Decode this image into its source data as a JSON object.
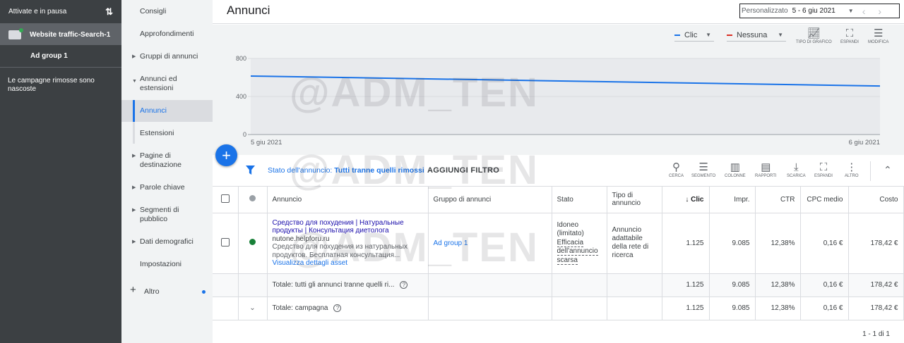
{
  "left_panel": {
    "filter_label": "Attivate e in pausa",
    "campaign": "Website traffic-Search-1",
    "ad_group": "Ad group 1",
    "note": "Le campagne rimosse sono nascoste"
  },
  "subnav": {
    "items": [
      {
        "label": "Consigli"
      },
      {
        "label": "Approfondimenti"
      },
      {
        "label": "Gruppi di annunci"
      },
      {
        "label": "Annunci ed estensioni"
      },
      {
        "label": "Annunci"
      },
      {
        "label": "Estensioni"
      },
      {
        "label": "Pagine di destinazione"
      },
      {
        "label": "Parole chiave"
      },
      {
        "label": "Segmenti di pubblico"
      },
      {
        "label": "Dati demografici"
      },
      {
        "label": "Impostazioni"
      },
      {
        "label": "Altro"
      }
    ]
  },
  "header": {
    "title": "Annunci",
    "date_label": "Personalizzato",
    "date_value": "5 - 6 giu 2021"
  },
  "chart_controls": {
    "metric1": "Clic",
    "metric2": "Nessuna",
    "metric1_color": "#1a73e8",
    "metric2_color": "#d93025",
    "chart_type": "TIPO DI GRAFICO",
    "expand": "ESPANDI",
    "edit": "MODIFICA"
  },
  "chart_data": {
    "type": "line",
    "x": [
      "5 giu 2021",
      "6 giu 2021"
    ],
    "series": [
      {
        "name": "Clic",
        "values": [
          615,
          510
        ]
      }
    ],
    "ylim": [
      0,
      800
    ],
    "yticks": [
      0,
      400,
      800
    ],
    "xlabels": [
      "5 giu 2021",
      "6 giu 2021"
    ],
    "grid": true
  },
  "filter": {
    "prefix": "Stato dell'annuncio:",
    "value": "Tutti tranne quelli rimossi",
    "add": "AGGIUNGI FILTRO"
  },
  "toolbar": {
    "search": "CERCA",
    "segment": "SEGMENTO",
    "columns": "COLONNE",
    "reports": "RAPPORTI",
    "download": "SCARICA",
    "expand": "ESPANDI",
    "more": "ALTRO"
  },
  "table": {
    "headers": {
      "ad": "Annuncio",
      "group": "Gruppo di annunci",
      "status": "Stato",
      "type": "Tipo di annuncio",
      "clicks": "Clic",
      "impr": "Impr.",
      "ctr": "CTR",
      "cpc": "CPC medio",
      "cost": "Costo"
    },
    "row": {
      "ad_headline": "Средство для похудения | Натуральные продукты | Консультация диетолога",
      "ad_url": "nutone.helpforu.ru",
      "ad_desc": "Средство для похудения из натуральных продуктов. Бесплатная консультация...",
      "ad_link": "Visualizza dettagli asset",
      "group": "Ad group 1",
      "status_line1": "Idoneo",
      "status_line2": "(limitato)",
      "status_line3": "Efficacia",
      "status_line4": "dell'annuncio",
      "status_line5": "scarsa",
      "type": "Annuncio adattabile della rete di ricerca",
      "clicks": "1.125",
      "impr": "9.085",
      "ctr": "12,38%",
      "cpc": "0,16 €",
      "cost": "178,42 €"
    },
    "total1": {
      "label": "Totale: tutti gli annunci tranne quelli ri...",
      "clicks": "1.125",
      "impr": "9.085",
      "ctr": "12,38%",
      "cpc": "0,16 €",
      "cost": "178,42 €"
    },
    "total2": {
      "label": "Totale: campagna",
      "clicks": "1.125",
      "impr": "9.085",
      "ctr": "12,38%",
      "cpc": "0,16 €",
      "cost": "178,42 €"
    }
  },
  "pager": "1 - 1 di 1",
  "watermark": "@ADM_TEN"
}
